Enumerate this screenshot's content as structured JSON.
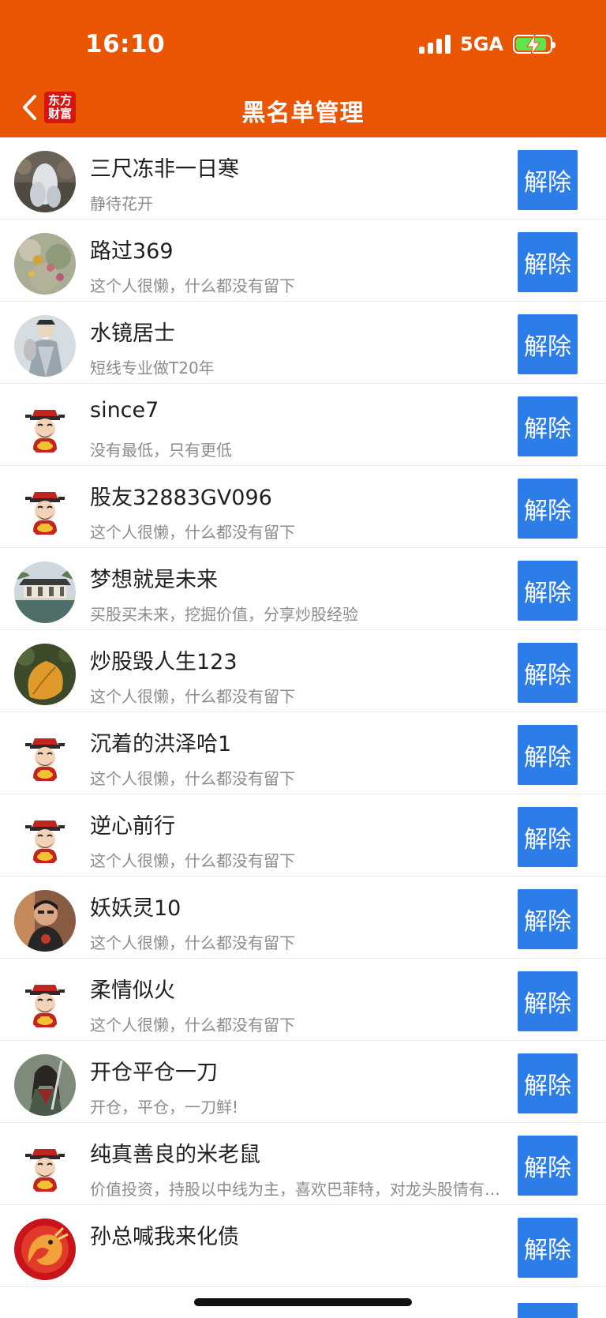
{
  "status_bar": {
    "time": "16:10",
    "network": "5GA",
    "battery_level": 0.9
  },
  "header": {
    "title": "黑名单管理",
    "logo_text_line1": "东方",
    "logo_text_line2": "财富",
    "back_icon": "chevron-left-icon"
  },
  "colors": {
    "header_bg": "#ea5504",
    "button_bg": "#2d7de8"
  },
  "blacklist": [
    {
      "name": "三尺冻非一日寒",
      "desc": "静待花开",
      "action": "解除",
      "avatar": "photo-waterfall"
    },
    {
      "name": "路过369",
      "desc": "这个人很懒，什么都没有留下",
      "action": "解除",
      "avatar": "photo-flowers"
    },
    {
      "name": "水镜居士",
      "desc": "短线专业做T20年",
      "action": "解除",
      "avatar": "photo-sage"
    },
    {
      "name": "since7",
      "desc": "没有最低，只有更低",
      "action": "解除",
      "avatar": "default-fortune-god"
    },
    {
      "name": "股友32883GV096",
      "desc": "这个人很懒，什么都没有留下",
      "action": "解除",
      "avatar": "default-fortune-god"
    },
    {
      "name": "梦想就是未来",
      "desc": "买股买未来，挖掘价值，分享炒股经验",
      "action": "解除",
      "avatar": "photo-pavilion"
    },
    {
      "name": "炒股毁人生123",
      "desc": "这个人很懒，什么都没有留下",
      "action": "解除",
      "avatar": "photo-leaf"
    },
    {
      "name": "沉着的洪泽哈1",
      "desc": "这个人很懒，什么都没有留下",
      "action": "解除",
      "avatar": "default-fortune-god"
    },
    {
      "name": "逆心前行",
      "desc": "这个人很懒，什么都没有留下",
      "action": "解除",
      "avatar": "default-fortune-god"
    },
    {
      "name": "妖妖灵10",
      "desc": "这个人很懒，什么都没有留下",
      "action": "解除",
      "avatar": "photo-person"
    },
    {
      "name": "柔情似火",
      "desc": "这个人很懒，什么都没有留下",
      "action": "解除",
      "avatar": "default-fortune-god"
    },
    {
      "name": "开仓平仓一刀",
      "desc": "开仓，平仓，一刀鲜!",
      "action": "解除",
      "avatar": "photo-warrior"
    },
    {
      "name": "纯真善良的米老鼠",
      "desc": "价值投资，持股以中线为主，喜欢巴菲特，对龙头股情有独钟",
      "action": "解除",
      "avatar": "default-fortune-god"
    },
    {
      "name": "孙总喊我来化债",
      "desc": "",
      "action": "解除",
      "avatar": "photo-dragon"
    }
  ]
}
